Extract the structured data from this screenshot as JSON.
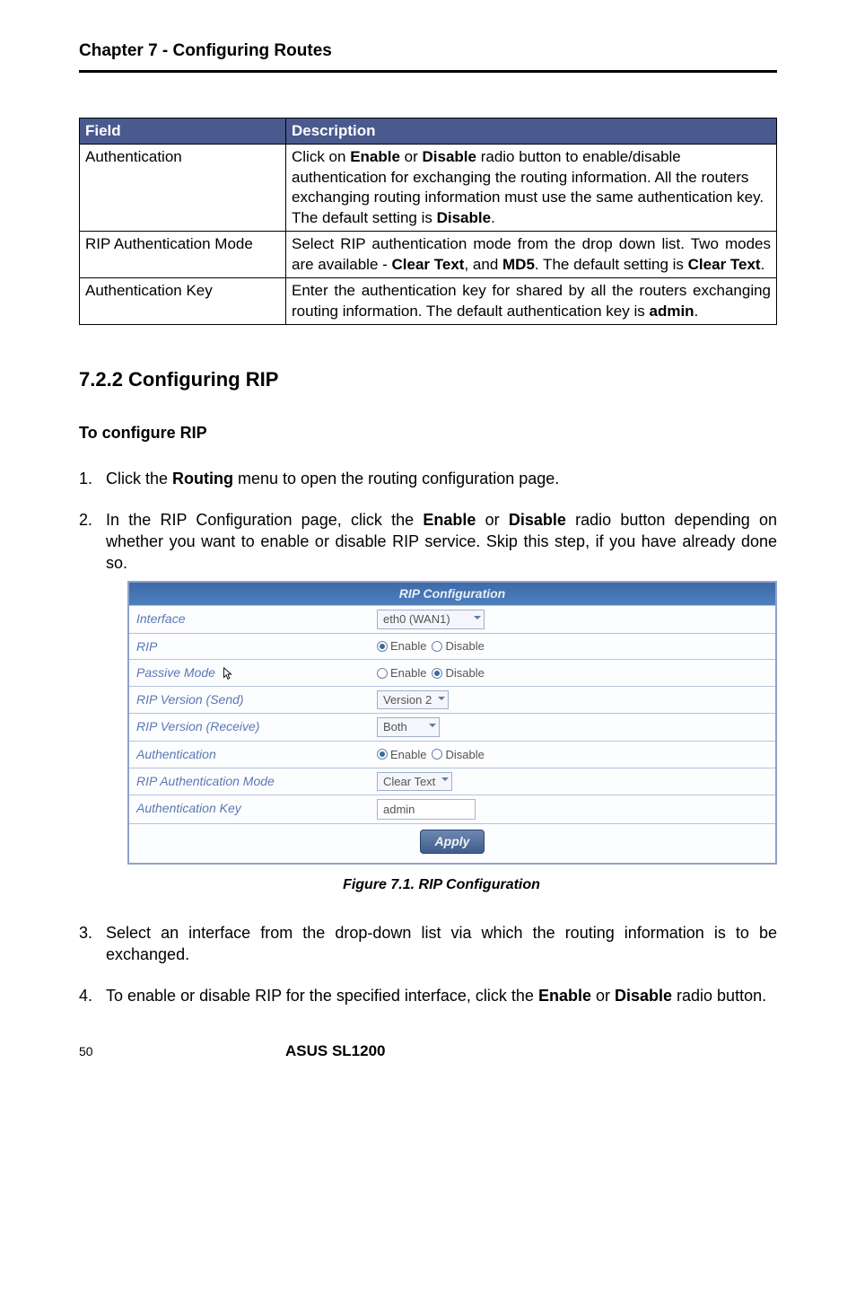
{
  "chapter_header": "Chapter 7 - Configuring Routes",
  "table": {
    "headers": [
      "Field",
      "Description"
    ],
    "rows": [
      {
        "field": "Authentication",
        "desc_html": "Click on <b>Enable</b> or <b>Disable</b> radio button to enable/disable authentication for exchanging the routing information. All the routers exchanging routing information must use the same authentication key. The default setting is <b>Disable</b>."
      },
      {
        "field": "RIP Authentication Mode",
        "desc_html": "Select RIP authentication mode from the drop down list. Two modes are available - <b>Clear Text</b>, and <b>MD5</b>. The default setting is <b>Clear Text</b>."
      },
      {
        "field": "Authentication Key",
        "desc_html": "Enter the authentication key for shared by all the routers exchanging routing information. The default authentication key is <b>admin</b>."
      }
    ]
  },
  "section_title": "7.2.2 Configuring RIP",
  "subsection_title": "To configure RIP",
  "steps": [
    {
      "num": "1.",
      "html": "Click the <b>Routing</b> menu to open the routing configuration page."
    },
    {
      "num": "2.",
      "html": "In the RIP Configuration page, click the <b>Enable</b> or <b>Disable</b> radio button depending on whether you want to enable or disable RIP service. Skip this step, if you have already done so."
    },
    {
      "num": "3.",
      "html": "Select an interface from the drop-down list via which the routing information is to be exchanged."
    },
    {
      "num": "4.",
      "html": "To enable or disable RIP for the specified interface, click the <b>Enable</b> or <b>Disable</b> radio button."
    }
  ],
  "rip_panel": {
    "title": "RIP Configuration",
    "rows": {
      "interface": {
        "label": "Interface",
        "value": "eth0 (WAN1)"
      },
      "rip": {
        "label": "RIP",
        "enable": "Enable",
        "disable": "Disable"
      },
      "passive_mode": {
        "label": "Passive Mode",
        "enable": "Enable",
        "disable": "Disable"
      },
      "version_send": {
        "label": "RIP Version (Send)",
        "value": "Version 2"
      },
      "version_receive": {
        "label": "RIP Version (Receive)",
        "value": "Both"
      },
      "authentication": {
        "label": "Authentication",
        "enable": "Enable",
        "disable": "Disable"
      },
      "auth_mode": {
        "label": "RIP Authentication Mode",
        "value": "Clear Text"
      },
      "auth_key": {
        "label": "Authentication Key",
        "value": "admin"
      }
    },
    "apply_label": "Apply"
  },
  "figure_caption": "Figure 7.1. RIP Configuration",
  "page_number": "50",
  "product_name": "ASUS SL1200"
}
